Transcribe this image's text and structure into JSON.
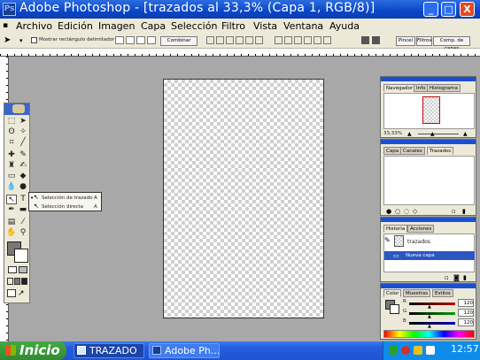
{
  "window": {
    "logo": "Ps",
    "title": "Adobe Photoshop - [trazados al 33,3% (Capa 1, RGB/8)]",
    "controls": {
      "minimize": "_",
      "maximize": "□",
      "close": "X"
    }
  },
  "menu": [
    "Archivo",
    "Edición",
    "Imagen",
    "Capa",
    "Selección",
    "Filtro",
    "Vista",
    "Ventana",
    "Ayuda"
  ],
  "options": {
    "checkbox_label": "Mostrar rectángulo delimitador",
    "combine_label": "Combinar",
    "palette_buttons": [
      "Pincel",
      "Filtros",
      "Comp. de capas"
    ]
  },
  "flyout": {
    "items": [
      {
        "label": "Selección de trazado",
        "shortcut": "A"
      },
      {
        "label": "Selección directa",
        "shortcut": "A"
      }
    ]
  },
  "panels": {
    "navigator": {
      "tabs": [
        "Navegador",
        "Info",
        "Histograma"
      ],
      "zoom": "33,33%"
    },
    "layers": {
      "tabs": [
        "Capa",
        "Canales",
        "Trazados"
      ]
    },
    "history": {
      "tabs": [
        "Historia",
        "Acciones"
      ],
      "items": [
        {
          "label": "trazados"
        },
        {
          "label": "Nueva capa"
        }
      ]
    },
    "color": {
      "tabs": [
        "Color",
        "Muestras",
        "Estilos"
      ],
      "channels": [
        {
          "label": "R",
          "value": "120",
          "slider": 0.47,
          "color": "#c00000"
        },
        {
          "label": "G",
          "value": "120",
          "slider": 0.47,
          "color": "#00a000"
        },
        {
          "label": "B",
          "value": "120",
          "slider": 0.47,
          "color": "#0000c0"
        }
      ]
    }
  },
  "taskbar": {
    "start": "Inicio",
    "tasks": [
      "TRAZADO",
      "Adobe Ph..."
    ],
    "clock": "12:57"
  },
  "colors": {
    "titlebar": "#0a46c8",
    "taskbar": "#245ee0",
    "start": "#2f8b2f",
    "panel_bg": "#ece9d8",
    "workspace": "#a8a8a8"
  }
}
